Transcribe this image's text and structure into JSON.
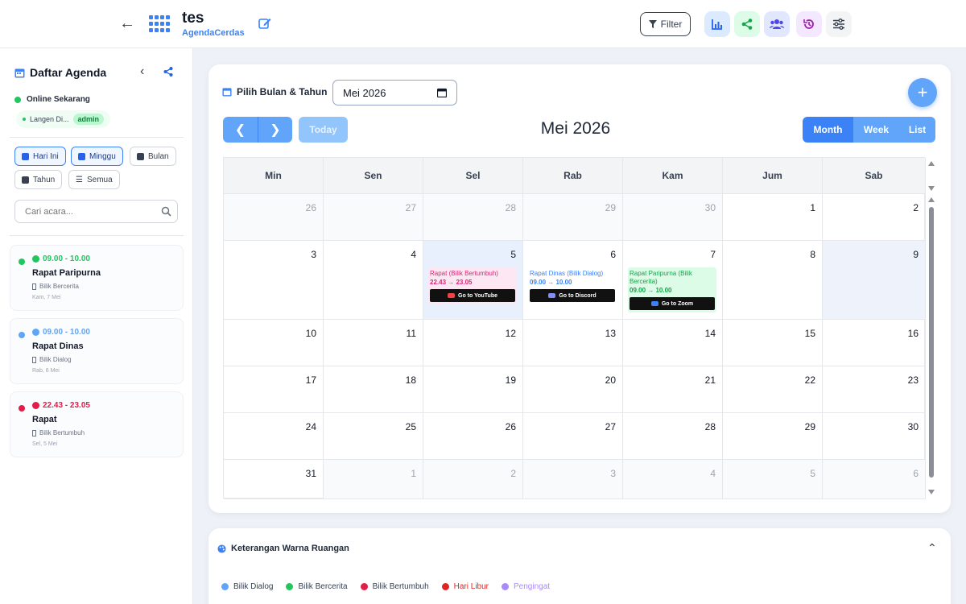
{
  "header": {
    "title": "tes",
    "subtitle": "AgendaCerdas",
    "filter_label": "Filter",
    "icon_buttons": [
      {
        "name": "chart",
        "bg": "#dbeafe",
        "fg": "#2563eb"
      },
      {
        "name": "share",
        "bg": "#dcfce7",
        "fg": "#16a34a"
      },
      {
        "name": "users",
        "bg": "#e0e7ff",
        "fg": "#4f46e5"
      },
      {
        "name": "history",
        "bg": "#f3e8ff",
        "fg": "#a21caf"
      },
      {
        "name": "settings",
        "bg": "#f3f4f6",
        "fg": "#374151"
      }
    ]
  },
  "sidebar": {
    "title": "Daftar Agenda",
    "online_label": "Online Sekarang",
    "user_name": "Langen Di...",
    "user_role": "admin",
    "filters": {
      "today": "Hari Ini",
      "week": "Minggu",
      "month": "Bulan",
      "year": "Tahun",
      "all": "Semua"
    },
    "search_placeholder": "Cari acara...",
    "events": [
      {
        "time": "09.00 - 10.00",
        "title": "Rapat Paripurna",
        "room": "Bilik Bercerita",
        "date": "Kam, 7 Mei",
        "color": "#22c55e"
      },
      {
        "time": "09.00 - 10.00",
        "title": "Rapat Dinas",
        "room": "Bilik Dialog",
        "date": "Rab, 6 Mei",
        "color": "#60a5fa"
      },
      {
        "time": "22.43 - 23.05",
        "title": "Rapat",
        "room": "Bilik Bertumbuh",
        "date": "Sel, 5 Mei",
        "color": "#e11d48"
      }
    ]
  },
  "calendar": {
    "pick_label": "Pilih Bulan & Tahun",
    "month_value": "Mei 2026",
    "title": "Mei 2026",
    "today_label": "Today",
    "views": {
      "month": "Month",
      "week": "Week",
      "list": "List"
    },
    "weekdays": [
      "Min",
      "Sen",
      "Sel",
      "Rab",
      "Kam",
      "Jum",
      "Sab"
    ],
    "weeks": [
      [
        "26",
        "27",
        "28",
        "29",
        "30",
        "1",
        "2"
      ],
      [
        "3",
        "4",
        "5",
        "6",
        "7",
        "8",
        "9"
      ],
      [
        "10",
        "11",
        "12",
        "13",
        "14",
        "15",
        "16"
      ],
      [
        "17",
        "18",
        "19",
        "20",
        "21",
        "22",
        "23"
      ],
      [
        "24",
        "25",
        "26",
        "27",
        "28",
        "29",
        "30"
      ],
      [
        "31",
        "1",
        "2",
        "3",
        "4",
        "5",
        "6"
      ]
    ],
    "events": [
      {
        "name": "Rapat (Bilik Bertumbuh)",
        "time": "22.43 → 23.05",
        "link": "Go to YouTube",
        "bg": "#fce7f3",
        "fg": "#db2777",
        "link_icon": "#ef4444"
      },
      {
        "name": "Rapat Dinas (Bilik Dialog)",
        "time": "09.00 → 10.00",
        "link": "Go to Discord",
        "bg": "#ffffff",
        "fg": "#3b82f6",
        "link_icon": "#818cf8"
      },
      {
        "name": "Rapat Paripurna (Bilik Bercerita)",
        "time": "09.00 → 10.00",
        "link": "Go to Zoom",
        "bg": "#dcfce7",
        "fg": "#16a34a",
        "link_icon": "#3b82f6"
      }
    ]
  },
  "legend": {
    "title": "Keterangan Warna Ruangan",
    "items": [
      {
        "label": "Bilik Dialog",
        "color": "#60a5fa"
      },
      {
        "label": "Bilik Bercerita",
        "color": "#22c55e"
      },
      {
        "label": "Bilik Bertumbuh",
        "color": "#e11d48"
      },
      {
        "label": "Hari Libur",
        "color": "#dc2626"
      },
      {
        "label": "Pengingat",
        "color": "#a78bfa"
      }
    ]
  }
}
